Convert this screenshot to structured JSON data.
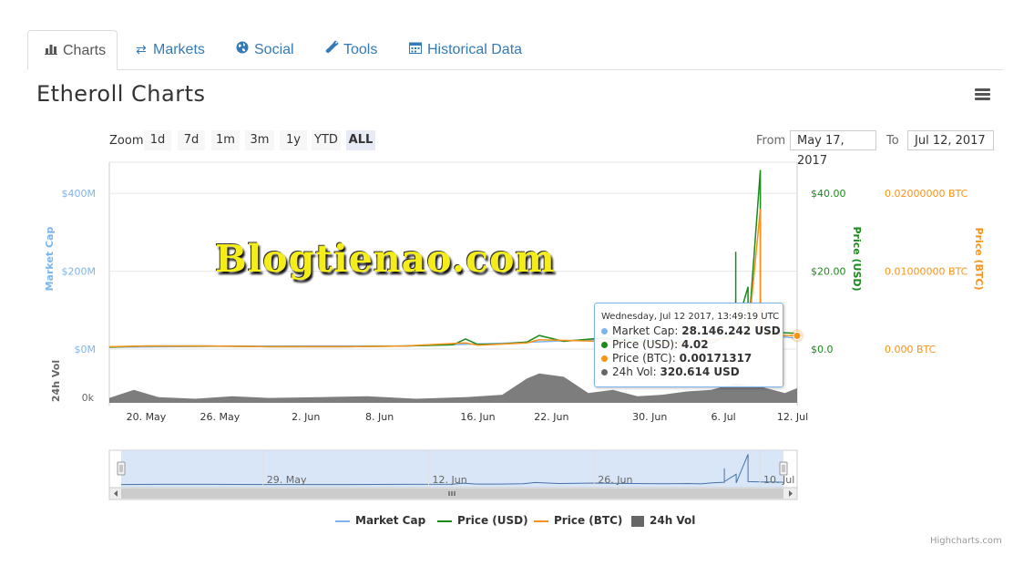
{
  "tabs": [
    {
      "label": "Charts",
      "icon": "bar-chart-icon",
      "active": true
    },
    {
      "label": "Markets",
      "icon": "exchange-arrows-icon"
    },
    {
      "label": "Social",
      "icon": "globe-icon"
    },
    {
      "label": "Tools",
      "icon": "wrench-icon"
    },
    {
      "label": "Historical Data",
      "icon": "calendar-icon"
    }
  ],
  "page": {
    "title": "Etheroll Charts"
  },
  "zoom": {
    "label": "Zoom",
    "buttons": [
      "1d",
      "7d",
      "1m",
      "3m",
      "1y",
      "YTD",
      "ALL"
    ],
    "selected": "ALL"
  },
  "range": {
    "from_label": "From",
    "from_value": "May 17, 2017",
    "to_label": "To",
    "to_value": "Jul 12, 2017"
  },
  "watermark": "Blogtienao.com",
  "tooltip": {
    "date": "Wednesday, Jul 12 2017, 13:49:19 UTC",
    "rows": [
      {
        "label": "Market Cap:",
        "value": "28.146.242 USD",
        "color": "#7cb5ec"
      },
      {
        "label": "Price (USD):",
        "value": "4.02",
        "color": "#1a8a1a"
      },
      {
        "label": "Price (BTC):",
        "value": "0.00171317",
        "color": "#f7931a"
      },
      {
        "label": "24h Vol:",
        "value": "320.614 USD",
        "color": "#666666"
      }
    ]
  },
  "legend": {
    "items": [
      "Market Cap",
      "Price (USD)",
      "Price (BTC)",
      "24h Vol"
    ]
  },
  "credits": "Highcharts.com",
  "colors": {
    "market_cap": "#7cb5ec",
    "price_usd": "#1a8a1a",
    "price_btc": "#f7931a",
    "volume": "#666666"
  },
  "chart_data": {
    "type": "line",
    "x_tick_labels": [
      "20. May",
      "26. May",
      "2. Jun",
      "8. Jun",
      "16. Jun",
      "22. Jun",
      "30. Jun",
      "6. Jul",
      "12. Jul"
    ],
    "x_range": [
      "2017-05-17",
      "2017-07-12"
    ],
    "series": [
      {
        "name": "Market Cap",
        "axis": "Market Cap",
        "dates": [
          "2017-05-17",
          "2017-05-25",
          "2017-06-02",
          "2017-06-10",
          "2017-06-18",
          "2017-06-26",
          "2017-07-03",
          "2017-07-08",
          "2017-07-12"
        ],
        "values": [
          5000000,
          7000000,
          8000000,
          8000000,
          15000000,
          25000000,
          30000000,
          40000000,
          28146242
        ]
      },
      {
        "name": "Price (USD)",
        "axis": "Price (USD)",
        "dates": [
          "2017-05-17",
          "2017-05-20",
          "2017-05-25",
          "2017-05-30",
          "2017-06-05",
          "2017-06-10",
          "2017-06-14",
          "2017-06-15",
          "2017-06-16",
          "2017-06-18",
          "2017-06-20",
          "2017-06-21",
          "2017-06-23",
          "2017-06-26",
          "2017-06-29",
          "2017-07-02",
          "2017-07-04",
          "2017-07-05",
          "2017-07-06",
          "2017-07-07",
          "2017-07-07",
          "2017-07-07",
          "2017-07-08",
          "2017-07-08",
          "2017-07-09",
          "2017-07-09",
          "2017-07-10",
          "2017-07-11",
          "2017-07-12"
        ],
        "values": [
          0.5,
          0.8,
          0.8,
          0.6,
          0.6,
          0.8,
          1.1,
          2.6,
          1.2,
          1.3,
          1.8,
          3.5,
          2.0,
          2.8,
          2.0,
          1.8,
          2.0,
          1.5,
          3.0,
          4.0,
          25.0,
          5.0,
          16.0,
          3.0,
          46.0,
          5.0,
          4.5,
          4.2,
          4.02
        ]
      },
      {
        "name": "Price (BTC)",
        "axis": "Price (BTC)",
        "dates": [
          "2017-05-17",
          "2017-05-20",
          "2017-05-25",
          "2017-05-30",
          "2017-06-05",
          "2017-06-10",
          "2017-06-15",
          "2017-06-16",
          "2017-06-20",
          "2017-06-21",
          "2017-06-26",
          "2017-07-02",
          "2017-07-07",
          "2017-07-07",
          "2017-07-08",
          "2017-07-09",
          "2017-07-09",
          "2017-07-10",
          "2017-07-12"
        ],
        "values": [
          0.0003,
          0.0004,
          0.0004,
          0.0003,
          0.0003,
          0.0004,
          0.0008,
          0.0005,
          0.0008,
          0.0012,
          0.001,
          0.0007,
          0.0015,
          0.005,
          0.0015,
          0.018,
          0.002,
          0.0018,
          0.00171317
        ]
      },
      {
        "name": "24h Vol",
        "axis": "24h Vol",
        "type": "area",
        "dates": [
          "2017-05-17",
          "2017-05-19",
          "2017-05-21",
          "2017-05-24",
          "2017-05-27",
          "2017-05-30",
          "2017-06-03",
          "2017-06-07",
          "2017-06-11",
          "2017-06-15",
          "2017-06-18",
          "2017-06-20",
          "2017-06-21",
          "2017-06-23",
          "2017-06-25",
          "2017-06-27",
          "2017-06-29",
          "2017-07-01",
          "2017-07-03",
          "2017-07-05",
          "2017-07-07",
          "2017-07-09",
          "2017-07-11",
          "2017-07-12"
        ],
        "values": [
          30,
          80,
          35,
          25,
          40,
          30,
          35,
          40,
          25,
          35,
          50,
          150,
          180,
          160,
          60,
          80,
          40,
          50,
          70,
          80,
          120,
          100,
          60,
          90
        ]
      }
    ],
    "axes": {
      "market_cap": {
        "title": "Market Cap",
        "ticks": [
          "$0M",
          "$200M",
          "$400M"
        ],
        "range": [
          0,
          480000000
        ]
      },
      "price_usd": {
        "title": "Price (USD)",
        "ticks": [
          "$0.0",
          "$20.00",
          "$40.00"
        ],
        "range": [
          0,
          48
        ]
      },
      "price_btc": {
        "title": "Price (BTC)",
        "ticks": [
          "0.000 BTC",
          "0.01000000 BTC",
          "0.02000000 BTC"
        ],
        "range": [
          0,
          0.024
        ]
      },
      "volume": {
        "title": "24h Vol",
        "ticks": [
          "0k"
        ]
      }
    },
    "navigator_labels": [
      "29. May",
      "12. Jun",
      "26. Jun",
      "10. Jul"
    ],
    "grid": true,
    "legend_position": "bottom-center"
  }
}
